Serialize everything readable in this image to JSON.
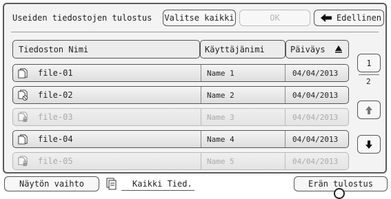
{
  "header": {
    "title": "Useiden tiedostojen tulostus",
    "select_all": "Valitse kaikki",
    "ok": "OK",
    "back": "Edellinen"
  },
  "columns": {
    "name": "Tiedoston Nimi",
    "user": "Käyttäjänimi",
    "date": "Päiväys"
  },
  "rows": [
    {
      "name": "file-01",
      "user": "Name 1",
      "date": "04/04/2013",
      "icon": "document-icon",
      "enabled": true
    },
    {
      "name": "file-02",
      "user": "Name 2",
      "date": "04/04/2013",
      "icon": "document-blocked-icon",
      "enabled": true
    },
    {
      "name": "file-03",
      "user": "Name 3",
      "date": "04/04/2013",
      "icon": "document-locked-icon",
      "enabled": false
    },
    {
      "name": "file-04",
      "user": "Name 4",
      "date": "04/04/2013",
      "icon": "document-icon",
      "enabled": true
    },
    {
      "name": "file-05",
      "user": "Name 5",
      "date": "04/04/2013",
      "icon": "document-locked-icon",
      "enabled": false
    }
  ],
  "pager": {
    "current": "1",
    "total": "2"
  },
  "footer": {
    "display_switch": "Näytön vaihto",
    "folder": "Kaikki Tied.",
    "batch_print": "Erän tulostus"
  }
}
